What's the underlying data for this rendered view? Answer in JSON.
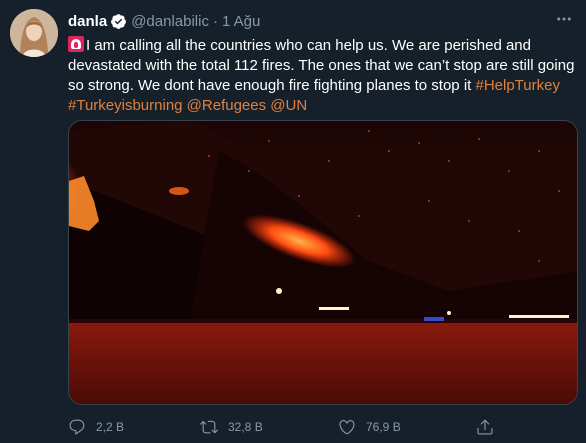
{
  "tweet": {
    "author_name": "danla",
    "handle": "@danlabilic",
    "separator": "·",
    "date": "1 Ağu",
    "text_main": "I am calling all the countries who can help us. We are perished and devastated with the total 112 fires. The ones that we can’t stop are still going so strong. We dont have enough fire fighting planes to stop it ",
    "links": [
      "#HelpTurkey",
      "#Turkeyisburning",
      "@Refugees",
      "@UN"
    ],
    "emoji_icon": "rotating-light-icon",
    "image_icon": "forest-fire-night-photo"
  },
  "actions": {
    "reply_count": "2,2 B",
    "retweet_count": "32,8 B",
    "like_count": "76,9 B"
  },
  "colors": {
    "background": "#15202b",
    "text": "#ffffff",
    "secondary": "#8899a6",
    "link": "#e0803d",
    "verified": "#ffffff"
  }
}
